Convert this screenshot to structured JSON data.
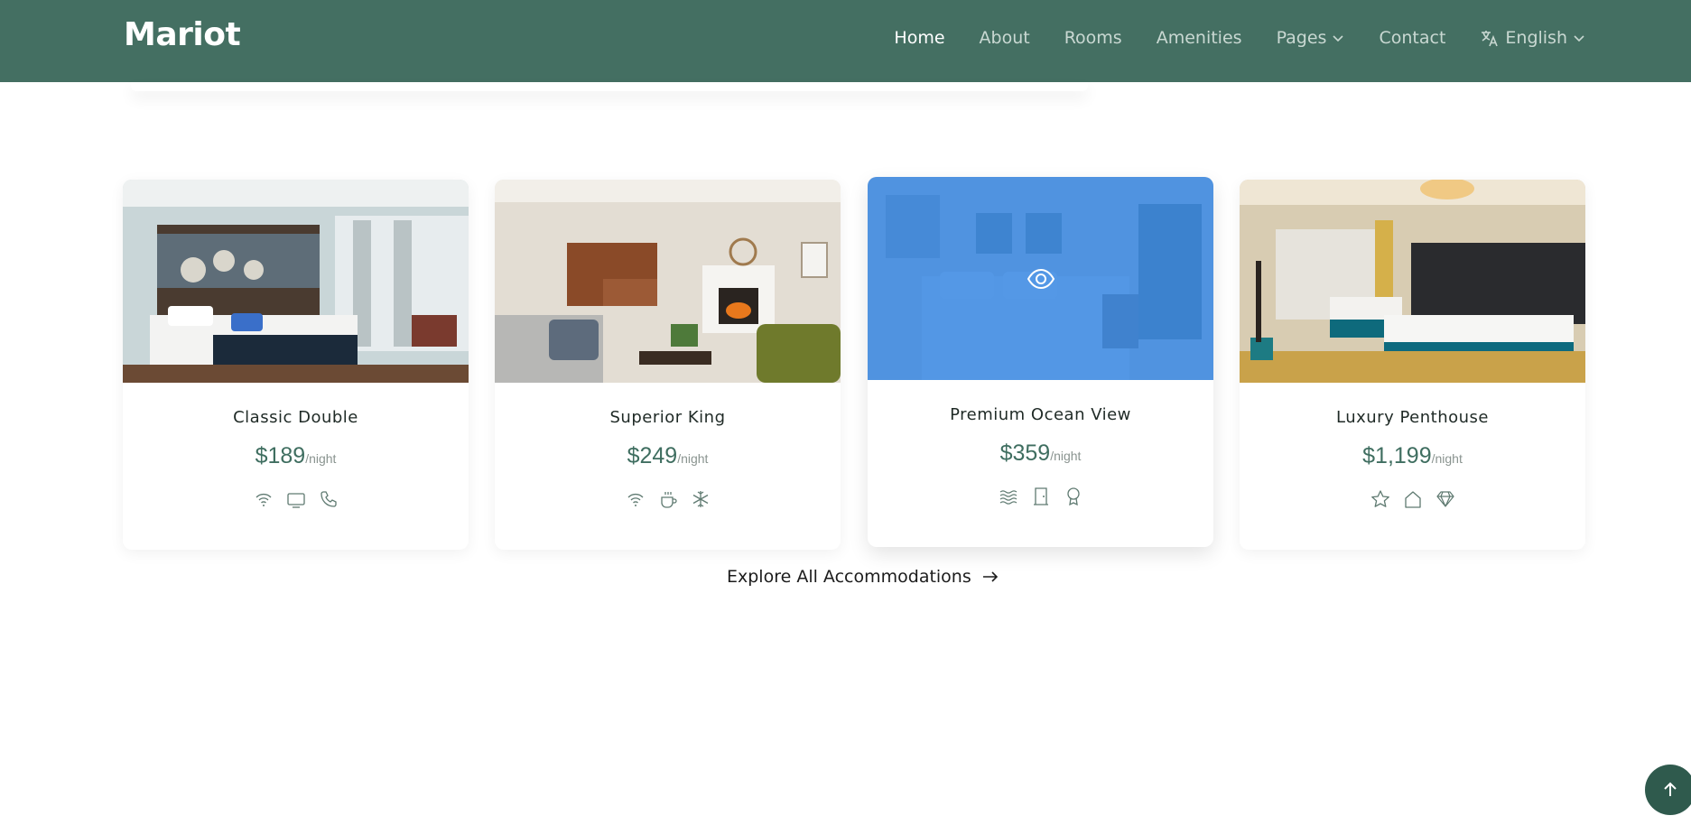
{
  "brand": {
    "name": "Mariot"
  },
  "nav": {
    "items": [
      {
        "label": "Home",
        "active": true
      },
      {
        "label": "About",
        "active": false
      },
      {
        "label": "Rooms",
        "active": false
      },
      {
        "label": "Amenities",
        "active": false
      },
      {
        "label": "Pages",
        "active": false,
        "dropdown": true
      },
      {
        "label": "Contact",
        "active": false
      }
    ],
    "language": {
      "label": "English",
      "icon": "translate-icon"
    }
  },
  "rooms": [
    {
      "title": "Classic Double",
      "price": "$189",
      "unit": "/night",
      "amenity_icons": [
        "wifi-icon",
        "tv-icon",
        "phone-icon"
      ]
    },
    {
      "title": "Superior King",
      "price": "$249",
      "unit": "/night",
      "amenity_icons": [
        "wifi-icon",
        "coffee-icon",
        "snowflake-icon"
      ]
    },
    {
      "title": "Premium Ocean View",
      "price": "$359",
      "unit": "/night",
      "amenity_icons": [
        "waves-icon",
        "door-icon",
        "award-icon"
      ],
      "hovered": true,
      "overlay_icon": "eye-icon"
    },
    {
      "title": "Luxury Penthouse",
      "price": "$1,199",
      "unit": "/night",
      "amenity_icons": [
        "star-icon",
        "home-icon",
        "diamond-icon"
      ]
    }
  ],
  "explore": {
    "label": "Explore All Accommodations"
  },
  "colors": {
    "navbar": "#446f62",
    "accent": "#3f6e60",
    "overlay": "#3c8ae2",
    "back_to_top": "#2f5a4d"
  }
}
